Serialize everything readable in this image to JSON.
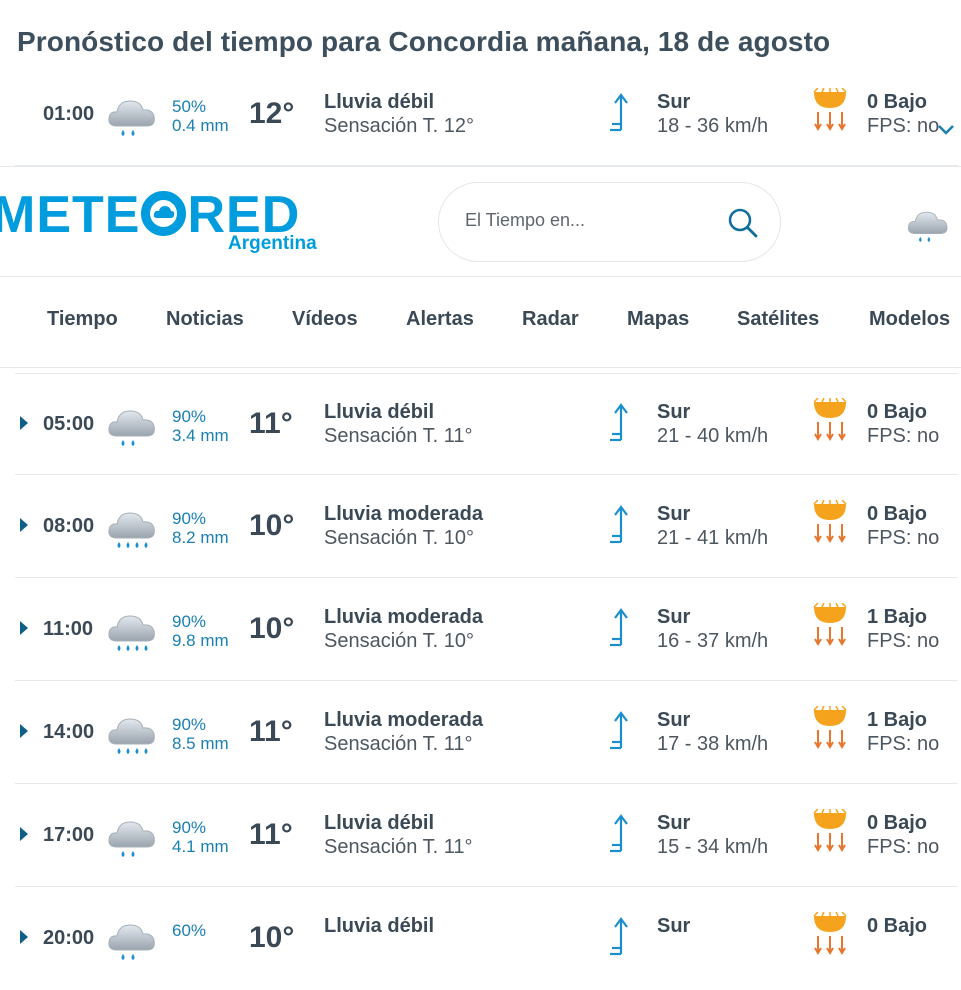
{
  "page": {
    "title": "Pronóstico del tiempo para Concordia mañana, 18 de agosto"
  },
  "colors": {
    "accent": "#009cde",
    "link": "#1a7fb3",
    "text": "#3a4955",
    "sun": "#f5a31c",
    "arrows": "#e8772e"
  },
  "header": {
    "logo_text_left": "METE",
    "logo_text_right": "RED",
    "logo_sub": "Argentina",
    "search_placeholder": "El Tiempo en...",
    "search_icon": "search-icon",
    "weather_icon": "cloud-rain-icon"
  },
  "nav": {
    "items": [
      {
        "label": "Tiempo"
      },
      {
        "label": "Noticias"
      },
      {
        "label": "Vídeos"
      },
      {
        "label": "Alertas"
      },
      {
        "label": "Radar"
      },
      {
        "label": "Mapas"
      },
      {
        "label": "Satélites"
      },
      {
        "label": "Modelos"
      }
    ]
  },
  "rows": [
    {
      "time": "01:00",
      "prob": "50%",
      "mm": "0.4 mm",
      "temp": "12°",
      "cond": "Lluvia débil",
      "feels": "Sensación T. 12°",
      "wdir": "Sur",
      "wspd": "18 - 36 km/h",
      "uv": "0 Bajo",
      "fps": "FPS: no",
      "icon": "light-rain-icon"
    },
    {
      "time": "05:00",
      "prob": "90%",
      "mm": "3.4 mm",
      "temp": "11°",
      "cond": "Lluvia débil",
      "feels": "Sensación T. 11°",
      "wdir": "Sur",
      "wspd": "21 - 40 km/h",
      "uv": "0 Bajo",
      "fps": "FPS: no",
      "icon": "light-rain-icon"
    },
    {
      "time": "08:00",
      "prob": "90%",
      "mm": "8.2 mm",
      "temp": "10°",
      "cond": "Lluvia moderada",
      "feels": "Sensación T. 10°",
      "wdir": "Sur",
      "wspd": "21 - 41 km/h",
      "uv": "0 Bajo",
      "fps": "FPS: no",
      "icon": "moderate-rain-icon"
    },
    {
      "time": "11:00",
      "prob": "90%",
      "mm": "9.8 mm",
      "temp": "10°",
      "cond": "Lluvia moderada",
      "feels": "Sensación T. 10°",
      "wdir": "Sur",
      "wspd": "16 - 37 km/h",
      "uv": "1 Bajo",
      "fps": "FPS: no",
      "icon": "moderate-rain-icon"
    },
    {
      "time": "14:00",
      "prob": "90%",
      "mm": "8.5 mm",
      "temp": "11°",
      "cond": "Lluvia moderada",
      "feels": "Sensación T. 11°",
      "wdir": "Sur",
      "wspd": "17 - 38 km/h",
      "uv": "1 Bajo",
      "fps": "FPS: no",
      "icon": "moderate-rain-icon"
    },
    {
      "time": "17:00",
      "prob": "90%",
      "mm": "4.1 mm",
      "temp": "11°",
      "cond": "Lluvia débil",
      "feels": "Sensación T. 11°",
      "wdir": "Sur",
      "wspd": "15 - 34 km/h",
      "uv": "0 Bajo",
      "fps": "FPS: no",
      "icon": "light-rain-icon"
    },
    {
      "time": "20:00",
      "prob": "60%",
      "mm": "",
      "temp": "10°",
      "cond": "Lluvia débil",
      "feels": "",
      "wdir": "Sur",
      "wspd": "",
      "uv": "0 Bajo",
      "fps": "",
      "icon": "light-rain-icon"
    }
  ]
}
